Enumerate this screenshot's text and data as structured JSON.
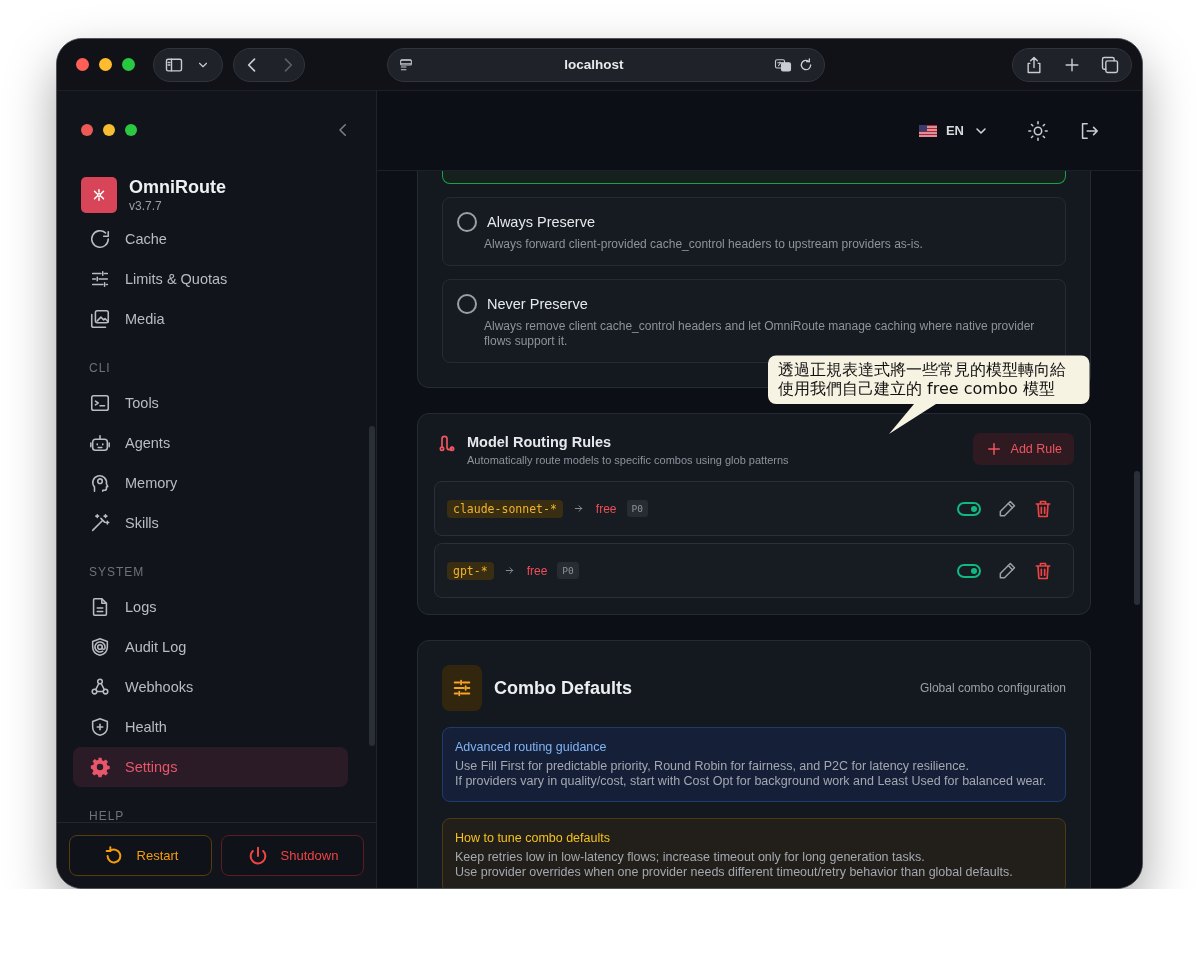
{
  "browser": {
    "url": "localhost",
    "back": {
      "disabled": false
    },
    "forward": {
      "disabled": true
    }
  },
  "sidebar": {
    "app_name": "OmniRoute",
    "version": "v3.7.7",
    "sections": [
      {
        "items": [
          {
            "label": "Cache",
            "selected": false
          },
          {
            "label": "Limits & Quotas",
            "selected": false
          },
          {
            "label": "Media",
            "selected": false
          }
        ]
      },
      {
        "title": "CLI",
        "items": [
          {
            "label": "Tools",
            "selected": false
          },
          {
            "label": "Agents",
            "selected": false
          },
          {
            "label": "Memory",
            "selected": false
          },
          {
            "label": "Skills",
            "selected": false
          }
        ]
      },
      {
        "title": "SYSTEM",
        "items": [
          {
            "label": "Logs",
            "selected": false
          },
          {
            "label": "Audit Log",
            "selected": false
          },
          {
            "label": "Webhooks",
            "selected": false
          },
          {
            "label": "Health",
            "selected": false
          },
          {
            "label": "Settings",
            "selected": true
          }
        ]
      },
      {
        "title": "HELP"
      }
    ],
    "footer_buttons": [
      {
        "label": "Restart",
        "kind": "restart"
      },
      {
        "label": "Shutdown",
        "kind": "shutdown"
      }
    ]
  },
  "header": {
    "language": "EN"
  },
  "cache_options": [
    {
      "selected": true
    },
    {
      "label": "Always Preserve",
      "description": "Always forward client-provided cache_control headers to upstream providers as-is.",
      "selected": false
    },
    {
      "label": "Never Preserve",
      "description": "Always remove client cache_control headers and let OmniRoute manage caching where native provider flows support it.",
      "selected": false
    }
  ],
  "annotation": {
    "lines": [
      "透過正規表達式將一些常見的模型轉向給",
      "使用我們自己建立的 free combo 模型"
    ]
  },
  "routing_rules": {
    "title": "Model Routing Rules",
    "subtitle": "Automatically route models to specific combos using glob patterns",
    "add_button": "Add Rule",
    "rules": [
      {
        "pattern": "claude-sonnet-*",
        "target": "free",
        "priority": "P0",
        "on": true
      },
      {
        "pattern": "gpt-*",
        "target": "free",
        "priority": "P0",
        "on": true
      }
    ]
  },
  "combo_defaults": {
    "title": "Combo Defaults",
    "subtitle": "Global combo configuration",
    "notes": [
      {
        "kind": "info",
        "title": "Advanced routing guidance",
        "lines": [
          "Use Fill First for predictable priority, Round Robin for fairness, and P2C for latency resilience.",
          "If providers vary in quality/cost, start with Cost Opt for background work and Least Used for balanced wear."
        ]
      },
      {
        "kind": "tip",
        "title": "How to tune combo defaults",
        "lines": [
          "Keep retries low in low-latency flows; increase timeout only for long generation tasks.",
          "Use provider overrides when one provider needs different timeout/retry behavior than global defaults."
        ]
      }
    ]
  }
}
